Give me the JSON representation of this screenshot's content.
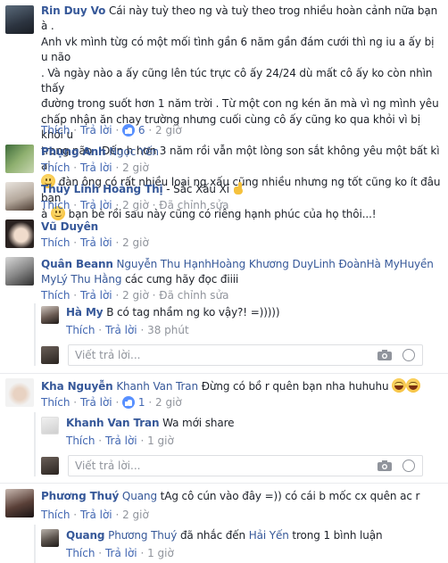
{
  "common": {
    "like": "Thích",
    "reply": "Trả lời",
    "edited": "Đã chỉnh sửa",
    "reply_placeholder": "Viết trả lời..."
  },
  "c1": {
    "name": "Rin Duy Vo",
    "text1": "Cái này tuỳ theo ng và tuỳ theo trog nhiều hoàn cảnh nữa bạn à .",
    "text2": "Anh vk mình từg có một mối tình gần 6 năm gần đám cưới thì ng iu a ấy bị u não",
    "text3": ". Và ngày nào a ấy cũng lên túc trực cô ấy 24/24 dù mất cô ấy ko còn nhìn thấy",
    "text4": "đường trong suốt hơn 1 năm trời . Từ một con ng kén ăn mà vì ng mình yêu",
    "text5": "chấp nhận ăn chay trường nhưng cuối cùng cô ấy cũng ko qua khỏi vì bị khối u",
    "text6": "trong não . Đến h hơn 3 năm rồi vẫn một lòng son sắt không yêu một bất kì ai",
    "text7": "đàn ông có rất nhiều loại ng xấu cũng nhiều nhưng ng tốt cũng ko ít đâu bạn",
    "text8a": "à",
    "text8b": "bạn bè rồi sau này cũng có riêng hạnh phúc của họ thôi...!",
    "likes": "6",
    "time": "2 giờ"
  },
  "c2": {
    "name": "Phụng Anh",
    "tag": "Ngọc Yến",
    "time": "2 giờ"
  },
  "c3": {
    "name": "Thùy Linh Hoàng Thị",
    "text": "- Sắc Xấu Xí",
    "time": "2 giờ"
  },
  "c4": {
    "name": "Vũ Duyên",
    "time": "2 giờ"
  },
  "c5": {
    "name": "Quân Beann",
    "tag1": "Nguyễn Thu Hạnh",
    "tag2": "Hoàng Khương Duy",
    "tag3": "Linh Đoàn",
    "tag4": "Hà My",
    "tag5": "Huyền",
    "tag6": "My",
    "tag7": "Lý Thu Hằng",
    "text": "các cưng hãy đọc điiii",
    "time": "2 giờ"
  },
  "r1": {
    "name": "Hà My",
    "text": "B có tag nhầm ng ko vậy?! =)))))",
    "time": "38 phút"
  },
  "c6": {
    "name": "Kha Nguyễn",
    "tag": "Khanh Van Tran",
    "text": "Đừng có bồ r quên bạn nha huhuhu",
    "likes": "1",
    "time": "2 giờ"
  },
  "r2": {
    "name": "Khanh Van Tran",
    "text": "Wa mới share",
    "time": "1 giờ"
  },
  "c7": {
    "name": "Phương Thuý",
    "tag": "Quang",
    "text": "tAg cô cún vào đây =)) có cái b mốc cx quên ac r",
    "time": "2 giờ"
  },
  "r3": {
    "name": "Quang",
    "tag1": "Phương Thuý",
    "mid": "đã nhắc đến",
    "tag2": "Hải Yến",
    "tail": "trong 1 bình luận",
    "time": "1 giờ"
  }
}
